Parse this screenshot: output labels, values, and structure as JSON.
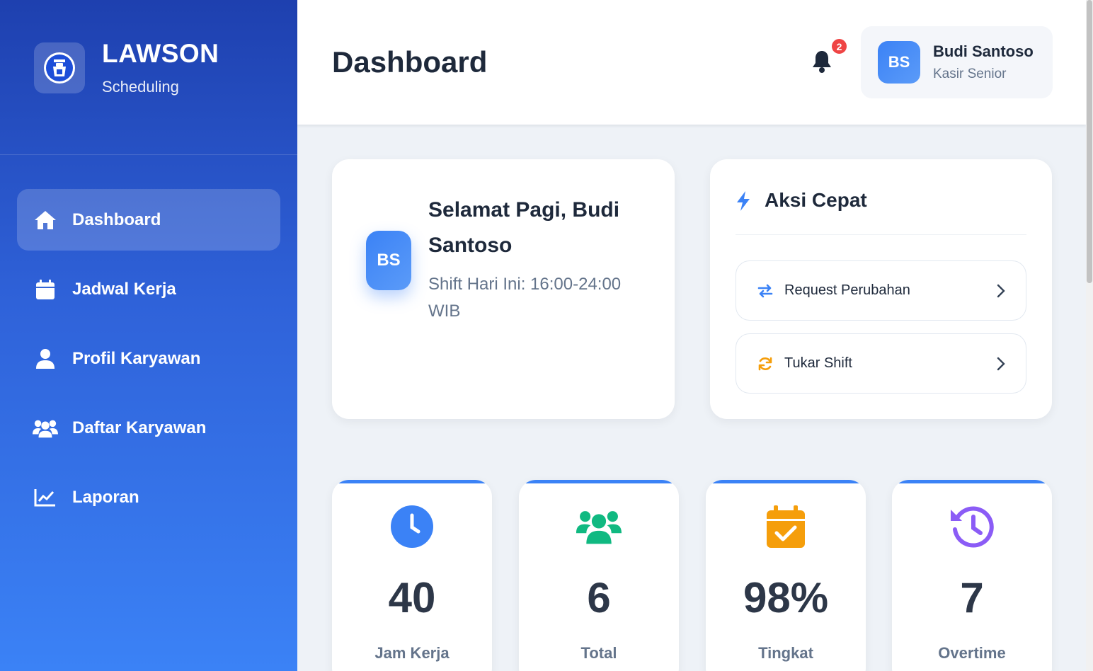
{
  "brand": {
    "title": "LAWSON",
    "subtitle": "Scheduling",
    "logo_icon": "lawson-station-logo"
  },
  "sidebar": {
    "items": [
      {
        "label": "Dashboard",
        "icon": "home-icon",
        "active": true
      },
      {
        "label": "Jadwal Kerja",
        "icon": "calendar-icon",
        "active": false
      },
      {
        "label": "Profil Karyawan",
        "icon": "user-icon",
        "active": false
      },
      {
        "label": "Daftar Karyawan",
        "icon": "users-icon",
        "active": false
      },
      {
        "label": "Laporan",
        "icon": "chart-line-icon",
        "active": false
      }
    ]
  },
  "header": {
    "title": "Dashboard",
    "notification_count": "2",
    "user": {
      "initials": "BS",
      "name": "Budi Santoso",
      "role": "Kasir Senior"
    }
  },
  "welcome": {
    "initials": "BS",
    "greeting": "Selamat Pagi, Budi Santoso",
    "shift": "Shift Hari Ini: 16:00-24:00 WIB"
  },
  "quick_actions": {
    "title": "Aksi Cepat",
    "icon": "bolt-icon",
    "items": [
      {
        "label": "Request Perubahan",
        "icon": "exchange-icon",
        "color": "#3b82f6"
      },
      {
        "label": "Tukar Shift",
        "icon": "sync-icon",
        "color": "#f59e0b"
      }
    ]
  },
  "stats": [
    {
      "value": "40",
      "label": "Jam Kerja",
      "icon": "clock-icon",
      "color": "#3b82f6"
    },
    {
      "value": "6",
      "label": "Total",
      "icon": "users-icon",
      "color": "#10b981"
    },
    {
      "value": "98%",
      "label": "Tingkat",
      "icon": "calendar-check-icon",
      "color": "#f59e0b"
    },
    {
      "value": "7",
      "label": "Overtime",
      "icon": "history-icon",
      "color": "#8b5cf6"
    }
  ],
  "colors": {
    "primary": "#3b82f6",
    "sidebar_dark": "#1e40af",
    "badge": "#ef4444"
  }
}
